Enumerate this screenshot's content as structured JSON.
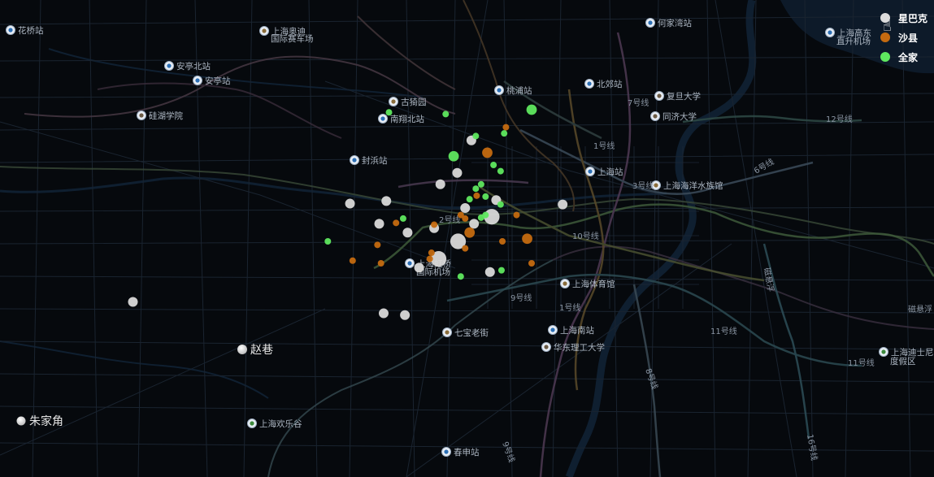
{
  "legend": [
    {
      "label": "星巴克",
      "color": "#dcdcdc"
    },
    {
      "label": "沙县",
      "color": "#c46a10"
    },
    {
      "label": "全家",
      "color": "#5fe85f"
    }
  ],
  "places": [
    {
      "label": "花桥站",
      "icon": "metro-icon"
    },
    {
      "label": "上海奥迪",
      "icon": "landmark-icon"
    },
    {
      "label": "国际赛车场",
      "icon": ""
    },
    {
      "label": "安亭北站",
      "icon": "metro-icon"
    },
    {
      "label": "安亭站",
      "icon": "metro-icon"
    },
    {
      "label": "硅湖学院",
      "icon": "school-icon"
    },
    {
      "label": "古猗园",
      "icon": "landmark-icon"
    },
    {
      "label": "南翔北站",
      "icon": "metro-icon"
    },
    {
      "label": "封浜站",
      "icon": "metro-icon"
    },
    {
      "label": "桃浦站",
      "icon": "metro-icon"
    },
    {
      "label": "北郊站",
      "icon": "metro-icon"
    },
    {
      "label": "何家湾站",
      "icon": "metro-icon"
    },
    {
      "label": "复旦大学",
      "icon": "school-icon"
    },
    {
      "label": "同济大学",
      "icon": "school-icon"
    },
    {
      "label": "上海站",
      "icon": "metro-icon"
    },
    {
      "label": "上海海洋水族馆",
      "icon": "landmark-icon"
    },
    {
      "label": "上海虹桥",
      "icon": "airport-icon"
    },
    {
      "label": "国际机场",
      "icon": ""
    },
    {
      "label": "上海体育馆",
      "icon": "landmark-icon"
    },
    {
      "label": "上海南站",
      "icon": "metro-icon"
    },
    {
      "label": "华东理工大学",
      "icon": "school-icon"
    },
    {
      "label": "七宝老街",
      "icon": "landmark-icon"
    },
    {
      "label": "上海欢乐谷",
      "icon": "park-icon"
    },
    {
      "label": "春申站",
      "icon": "metro-icon"
    },
    {
      "label": "上海高东",
      "icon": "airport-icon"
    },
    {
      "label": "直升机场",
      "icon": ""
    },
    {
      "label": "上海迪士尼",
      "icon": "park-icon"
    },
    {
      "label": "度假区",
      "icon": ""
    }
  ],
  "line_labels": [
    "12号线",
    "2号线",
    "6号线",
    "9号线",
    "11号线",
    "11号线",
    "10号线",
    "1号线",
    "8号线",
    "磁悬浮",
    "磁悬浮",
    "16号线",
    "9号线",
    "3号线",
    "1号线",
    "7号线"
  ],
  "towns": [
    {
      "label": "赵巷"
    },
    {
      "label": "朱家角"
    }
  ],
  "markers": {
    "starbucks": [
      {
        "lon": 121.472,
        "lat": 31.305
      },
      {
        "lon": 121.456,
        "lat": 31.268
      },
      {
        "lon": 121.437,
        "lat": 31.255
      },
      {
        "lon": 121.5,
        "lat": 31.237
      },
      {
        "lon": 121.465,
        "lat": 31.228
      },
      {
        "lon": 121.495,
        "lat": 31.218
      },
      {
        "lon": 121.475,
        "lat": 31.21
      },
      {
        "lon": 121.43,
        "lat": 31.205
      },
      {
        "lon": 121.4,
        "lat": 31.2
      },
      {
        "lon": 121.457,
        "lat": 31.19
      },
      {
        "lon": 121.435,
        "lat": 31.17
      },
      {
        "lon": 121.493,
        "lat": 31.155
      },
      {
        "lon": 121.376,
        "lat": 31.236
      },
      {
        "lon": 121.368,
        "lat": 31.21
      },
      {
        "lon": 121.335,
        "lat": 31.233
      },
      {
        "lon": 121.575,
        "lat": 31.232
      },
      {
        "lon": 121.397,
        "lat": 31.106
      },
      {
        "lon": 121.373,
        "lat": 31.108
      },
      {
        "lon": 121.413,
        "lat": 31.16
      },
      {
        "lon": 121.09,
        "lat": 31.121
      }
    ],
    "shaxian": [
      {
        "lon": 121.49,
        "lat": 31.291
      },
      {
        "lon": 121.465,
        "lat": 31.216
      },
      {
        "lon": 121.43,
        "lat": 31.209
      },
      {
        "lon": 121.47,
        "lat": 31.2
      },
      {
        "lon": 121.507,
        "lat": 31.19
      },
      {
        "lon": 121.535,
        "lat": 31.193
      },
      {
        "lon": 121.387,
        "lat": 31.211
      },
      {
        "lon": 121.366,
        "lat": 31.186
      },
      {
        "lon": 121.338,
        "lat": 31.168
      },
      {
        "lon": 121.37,
        "lat": 31.165
      },
      {
        "lon": 121.427,
        "lat": 31.177
      },
      {
        "lon": 121.465,
        "lat": 31.182
      },
      {
        "lon": 121.54,
        "lat": 31.165
      },
      {
        "lon": 121.523,
        "lat": 31.22
      },
      {
        "lon": 121.478,
        "lat": 31.242
      },
      {
        "lon": 121.46,
        "lat": 31.22
      },
      {
        "lon": 121.511,
        "lat": 31.32
      },
      {
        "lon": 121.425,
        "lat": 31.17
      }
    ],
    "familymart": [
      {
        "lon": 121.54,
        "lat": 31.34
      },
      {
        "lon": 121.443,
        "lat": 31.335
      },
      {
        "lon": 121.379,
        "lat": 31.337
      },
      {
        "lon": 121.477,
        "lat": 31.31
      },
      {
        "lon": 121.497,
        "lat": 31.277
      },
      {
        "lon": 121.505,
        "lat": 31.27
      },
      {
        "lon": 121.47,
        "lat": 31.238
      },
      {
        "lon": 121.483,
        "lat": 31.255
      },
      {
        "lon": 121.477,
        "lat": 31.25
      },
      {
        "lon": 121.452,
        "lat": 31.287
      },
      {
        "lon": 121.505,
        "lat": 31.232
      },
      {
        "lon": 121.395,
        "lat": 31.216
      },
      {
        "lon": 121.483,
        "lat": 31.217
      },
      {
        "lon": 121.488,
        "lat": 31.22
      },
      {
        "lon": 121.506,
        "lat": 31.157
      },
      {
        "lon": 121.46,
        "lat": 31.15
      },
      {
        "lon": 121.31,
        "lat": 31.19
      },
      {
        "lon": 121.509,
        "lat": 31.313
      },
      {
        "lon": 121.488,
        "lat": 31.241
      }
    ]
  }
}
